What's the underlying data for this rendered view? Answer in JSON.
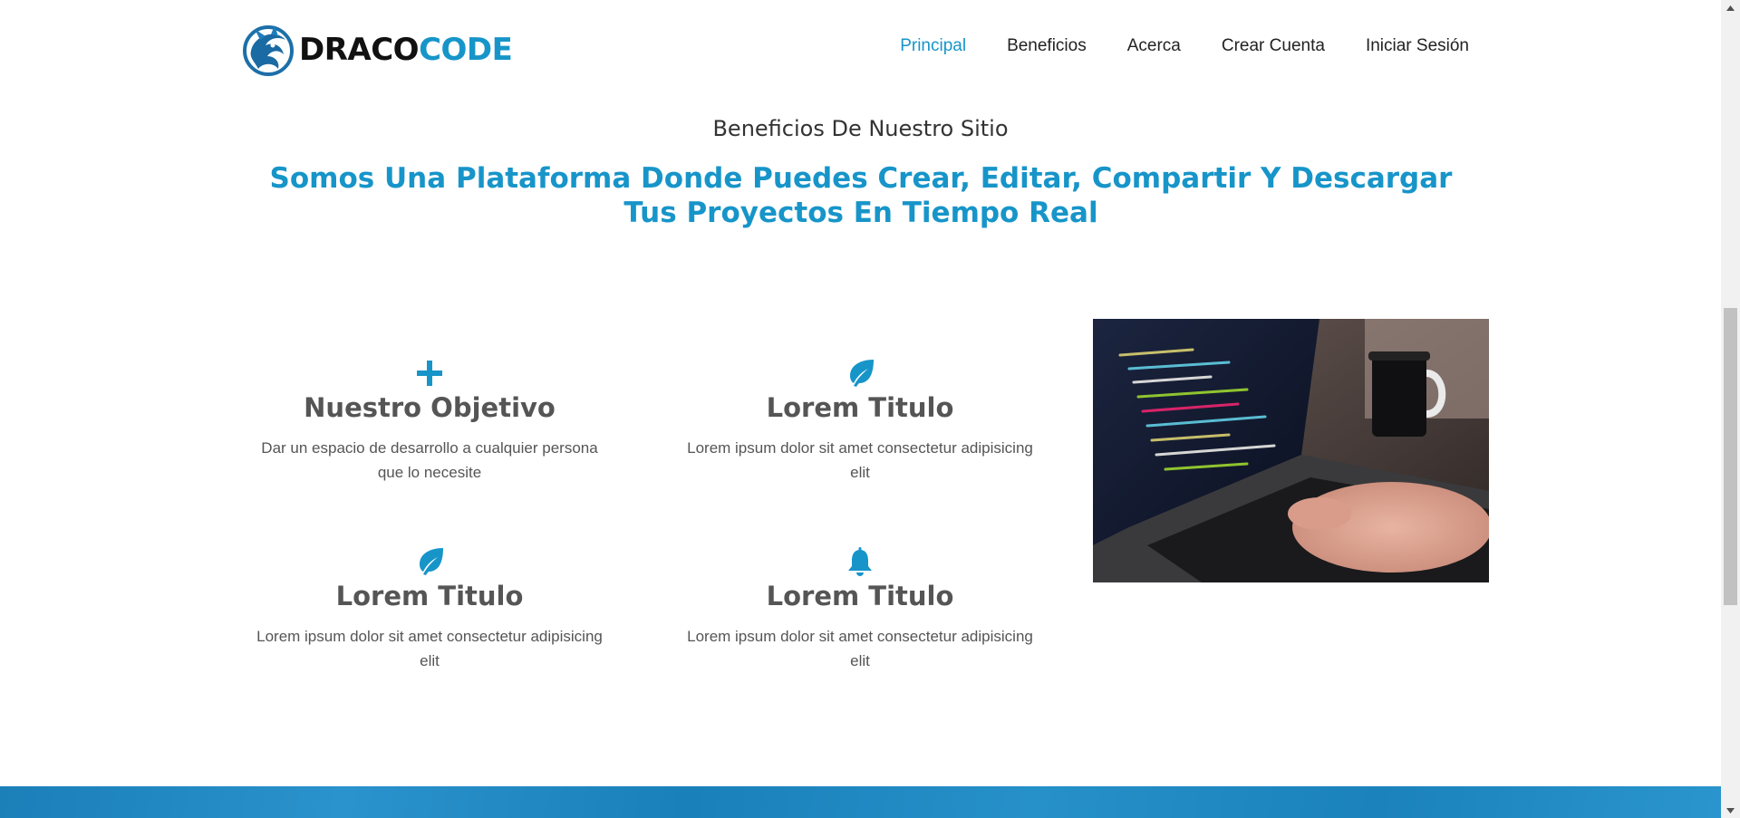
{
  "brand": {
    "name_dark": "DRACO",
    "name_blue": "CODE"
  },
  "nav": [
    {
      "label": "Principal",
      "active": true
    },
    {
      "label": "Beneficios"
    },
    {
      "label": "Acerca"
    },
    {
      "label": "Crear Cuenta"
    },
    {
      "label": "Iniciar Sesión"
    }
  ],
  "section": {
    "kicker": "Beneficios De Nuestro Sitio",
    "headline": "Somos Una Plataforma Donde Puedes Crear, Editar, Compartir Y Descargar Tus Proyectos En Tiempo Real"
  },
  "features": [
    {
      "icon": "plus-icon",
      "title": "Nuestro Objetivo",
      "text": "Dar un espacio de desarrollo a cualquier persona que lo necesite"
    },
    {
      "icon": "leaf-icon",
      "title": "Lorem Titulo",
      "text": "Lorem ipsum dolor sit amet consectetur adipisicing elit"
    },
    {
      "icon": "leaf-icon",
      "title": "Lorem Titulo",
      "text": "Lorem ipsum dolor sit amet consectetur adipisicing elit"
    },
    {
      "icon": "bell-icon",
      "title": "Lorem Titulo",
      "text": "Lorem ipsum dolor sit amet consectetur adipisicing elit"
    }
  ],
  "colors": {
    "accent": "#1795c9",
    "text": "#555555",
    "band": "#1b82bb"
  }
}
